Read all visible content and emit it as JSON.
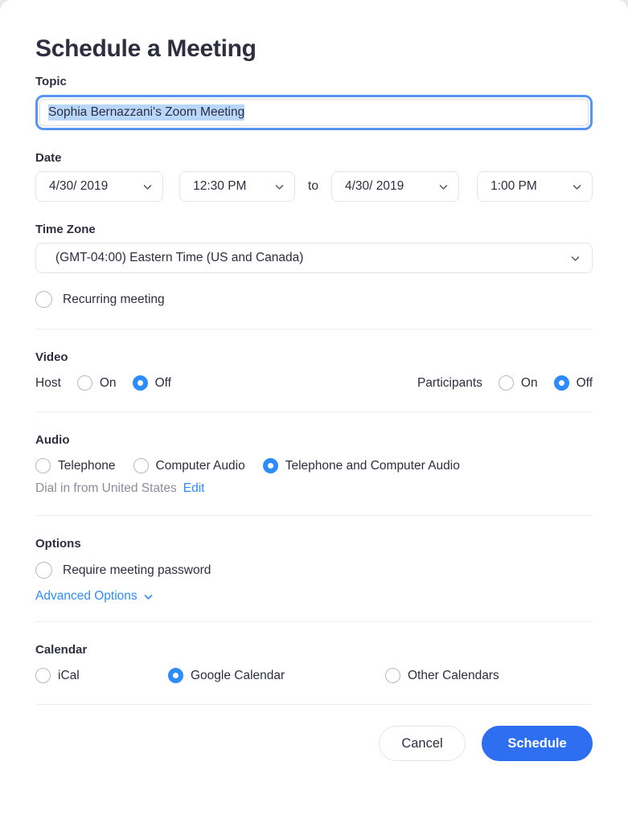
{
  "dialog": {
    "title": "Schedule a Meeting"
  },
  "topic": {
    "label": "Topic",
    "value": "Sophia Bernazzani's Zoom Meeting",
    "placeholder": "Topic"
  },
  "date": {
    "label": "Date",
    "start_date": "4/30/ 2019",
    "start_time": "12:30 PM",
    "separator": "to",
    "end_date": "4/30/ 2019",
    "end_time": "1:00 PM"
  },
  "timezone": {
    "label": "Time Zone",
    "value": "(GMT-04:00) Eastern Time (US and Canada)"
  },
  "recurring": {
    "label": "Recurring meeting",
    "checked": false
  },
  "video": {
    "label": "Video",
    "host": {
      "label": "Host",
      "options": [
        "On",
        "Off"
      ],
      "selected": "Off"
    },
    "participants": {
      "label": "Participants",
      "options": [
        "On",
        "Off"
      ],
      "selected": "Off"
    }
  },
  "audio": {
    "label": "Audio",
    "options": [
      "Telephone",
      "Computer Audio",
      "Telephone and Computer Audio"
    ],
    "selected": "Telephone and Computer Audio",
    "dial_in_text": "Dial in from United States",
    "edit_link": "Edit"
  },
  "options": {
    "label": "Options",
    "require_password_label": "Require meeting password",
    "require_password_checked": false,
    "advanced_label": "Advanced Options"
  },
  "calendar": {
    "label": "Calendar",
    "options": [
      "iCal",
      "Google Calendar",
      "Other Calendars"
    ],
    "selected": "Google Calendar"
  },
  "footer": {
    "cancel_label": "Cancel",
    "schedule_label": "Schedule"
  },
  "colors": {
    "accent_blue": "#2d8cff",
    "button_blue": "#2d6ff0",
    "focus_ring": "#5596f5",
    "selection": "#b9d6fb",
    "text": "#2d2e3f",
    "muted": "#8b8d9b",
    "divider": "#eceef3"
  },
  "icons": {
    "chevron_down": "chevron-down-icon"
  }
}
